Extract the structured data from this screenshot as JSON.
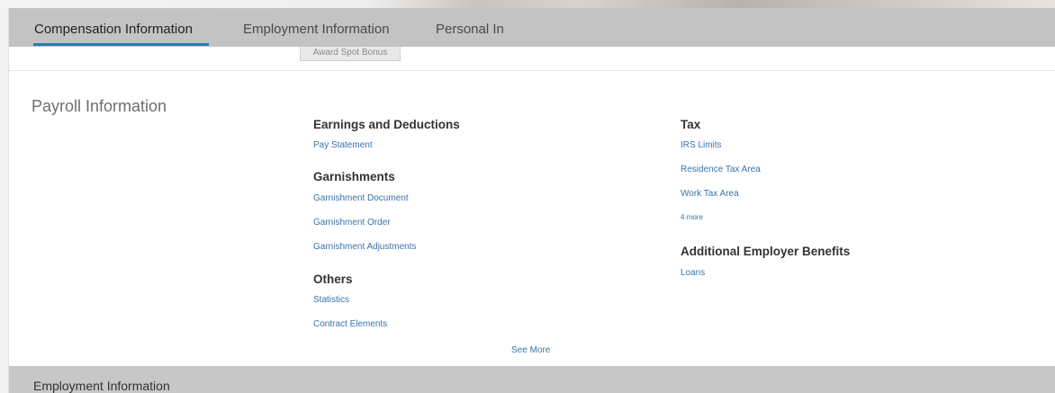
{
  "tabs": [
    {
      "label": "Compensation Information"
    },
    {
      "label": "Employment Information"
    },
    {
      "label": "Personal In"
    }
  ],
  "stub_button": "Award Spot Bonus",
  "payroll": {
    "title": "Payroll Information",
    "earnings": {
      "title": "Earnings and Deductions",
      "links": [
        "Pay Statement"
      ]
    },
    "garnishments": {
      "title": "Garnishments",
      "links": [
        "Garnishment Document",
        "Garnishment Order",
        "Garnishment Adjustments"
      ]
    },
    "others": {
      "title": "Others",
      "links": [
        "Statistics",
        "Contract Elements"
      ]
    },
    "tax": {
      "title": "Tax",
      "links": [
        "IRS Limits",
        "Residence Tax Area",
        "Work Tax Area"
      ],
      "more": "4 more"
    },
    "benefits": {
      "title": "Additional Employer Benefits",
      "links": [
        "Loans"
      ]
    },
    "see_more": "See More"
  },
  "bottom_section": {
    "title": "Employment Information"
  }
}
